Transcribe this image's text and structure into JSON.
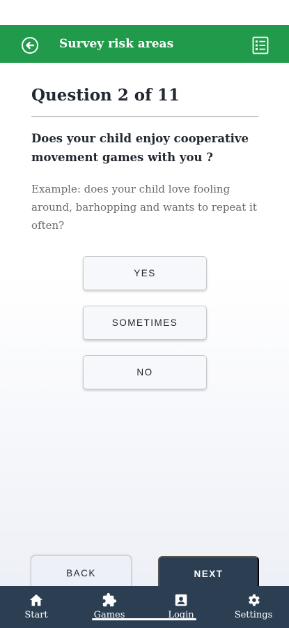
{
  "app_bar": {
    "title": "Survey risk areas",
    "back_icon": "arrow-left-circle-icon",
    "list_icon": "checklist-icon",
    "color": "#229a4b"
  },
  "question": {
    "counter": "Question 2 of 11",
    "text": "Does your child enjoy cooperative movement games with you ?",
    "example": "Example: does your child love fooling around, barhopping and wants to repeat it often?"
  },
  "answers": [
    "YES",
    "SOMETIMES",
    "NO"
  ],
  "navigation": {
    "back_label": "BACK",
    "next_label": "NEXT"
  },
  "bottom_nav": {
    "color": "#2c3f52",
    "items": [
      {
        "label": "Start",
        "icon": "home-icon"
      },
      {
        "label": "Games",
        "icon": "puzzle-icon"
      },
      {
        "label": "Login",
        "icon": "account-box-icon"
      },
      {
        "label": "Settings",
        "icon": "gear-icon"
      }
    ]
  }
}
